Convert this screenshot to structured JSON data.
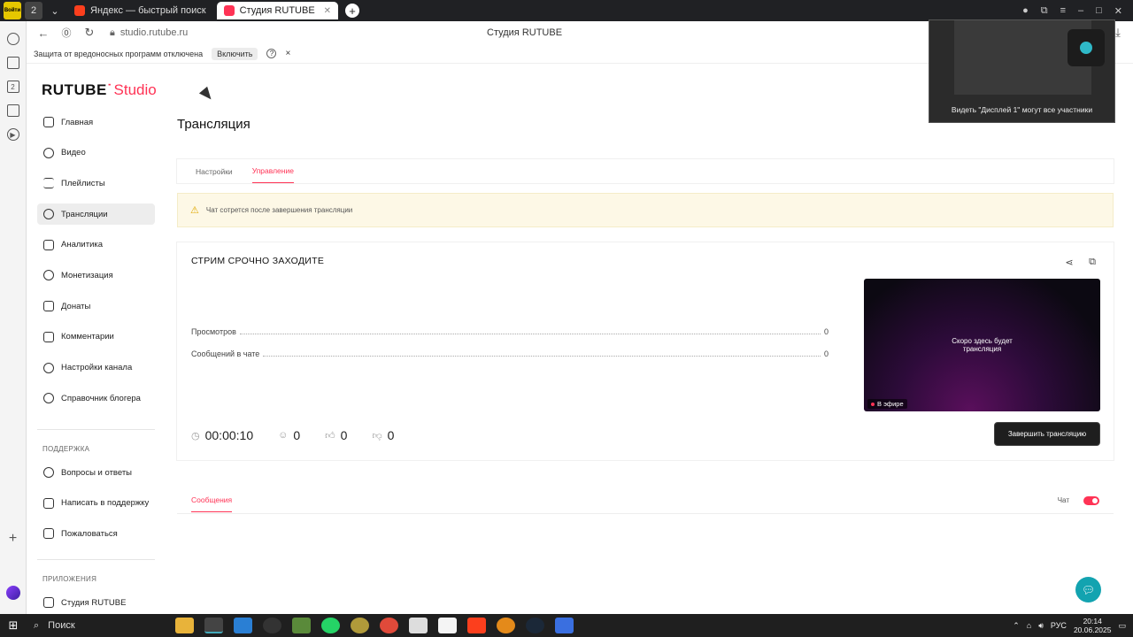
{
  "browser": {
    "badge_label": "Войти",
    "tab_count": "2",
    "tabs": [
      {
        "title": "Яндекс — быстрый поиск"
      },
      {
        "title": "Студия RUTUBE"
      }
    ],
    "url": "studio.rutube.ru",
    "page_title": "Студия RUTUBE",
    "notice": {
      "text": "Защита от вредоносных программ отключена",
      "enable_label": "Включить",
      "help": "?",
      "close": "×"
    }
  },
  "studio": {
    "logo_main": "RUTUBE",
    "logo_sub": "Studio",
    "menu": [
      {
        "label": "Главная"
      },
      {
        "label": "Видео"
      },
      {
        "label": "Плейлисты"
      },
      {
        "label": "Трансляции"
      },
      {
        "label": "Аналитика"
      },
      {
        "label": "Монетизация"
      },
      {
        "label": "Донаты"
      },
      {
        "label": "Комментарии"
      },
      {
        "label": "Настройки канала"
      },
      {
        "label": "Справочник блогера"
      }
    ],
    "support_title": "ПОДДЕРЖКА",
    "support_menu": [
      {
        "label": "Вопросы и ответы"
      },
      {
        "label": "Написать в поддержку"
      },
      {
        "label": "Пожаловаться"
      }
    ],
    "apps_title": "ПРИЛОЖЕНИЯ",
    "apps_menu": [
      {
        "label": "Студия RUTUBE"
      }
    ]
  },
  "main": {
    "title": "Трансляция",
    "tabs": [
      {
        "label": "Настройки"
      },
      {
        "label": "Управление"
      }
    ],
    "warning": "Чат сотрется после завершения трансляции",
    "stream": {
      "title": "СТРИМ СРОЧНО ЗАХОДИТЕ",
      "stats": [
        {
          "label": "Просмотров",
          "value": "0"
        },
        {
          "label": "Сообщений в чате",
          "value": "0"
        }
      ],
      "duration": "00:00:10",
      "viewers": "0",
      "likes": "0",
      "dislikes": "0",
      "preview_text": "Скоро здесь будет трансляция",
      "live_label": "В эфире",
      "end_button": "Завершить трансляцию"
    },
    "messages_tab": "Сообщения",
    "chat_label": "Чат"
  },
  "overlay": {
    "caption": "Видеть \"Дисплей 1\" могут все участники"
  },
  "taskbar": {
    "search_label": "Поиск",
    "lang": "РУС",
    "time": "20:14",
    "date": "20.06.2025"
  }
}
